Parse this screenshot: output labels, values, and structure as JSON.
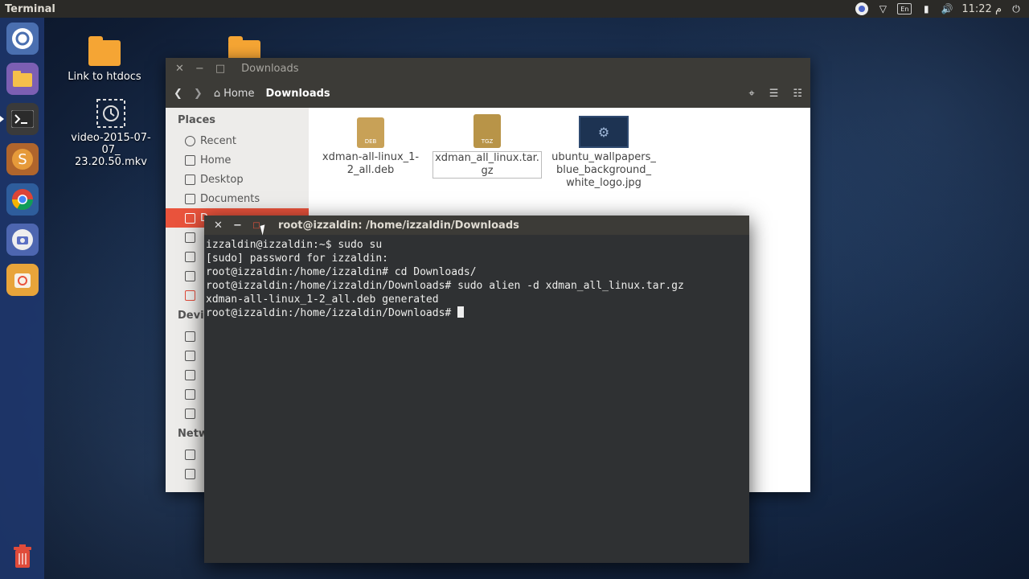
{
  "top_panel": {
    "app_title": "Terminal",
    "kbd": "En",
    "clock": "11:22 م"
  },
  "desktop": {
    "icons": [
      {
        "label": "Link to htdocs"
      },
      {
        "label": ""
      },
      {
        "label": "video-2015-07-07_\n23.20.50.mkv"
      }
    ]
  },
  "file_manager": {
    "title": "Downloads",
    "breadcrumb": {
      "home": "Home",
      "current": "Downloads"
    },
    "sidebar": {
      "places_header": "Places",
      "items": [
        "Recent",
        "Home",
        "Desktop",
        "Documents",
        "D"
      ],
      "devices_header": "Devi",
      "network_header": "Netw"
    },
    "files": [
      {
        "name": "xdman-all-linux_1-\n2_all.deb",
        "badge": "DEB"
      },
      {
        "name": "xdman_all_linux.tar.\ngz",
        "badge": "TGZ"
      },
      {
        "name": "ubuntu_wallpapers_\nblue_background_\nwhite_logo.jpg",
        "badge": ""
      }
    ]
  },
  "terminal": {
    "title": "root@izzaldin: /home/izzaldin/Downloads",
    "lines": [
      "izzaldin@izzaldin:~$ sudo su",
      "[sudo] password for izzaldin:",
      "root@izzaldin:/home/izzaldin# cd Downloads/",
      "root@izzaldin:/home/izzaldin/Downloads# sudo alien -d xdman_all_linux.tar.gz",
      "xdman-all-linux_1-2_all.deb generated",
      "root@izzaldin:/home/izzaldin/Downloads# "
    ]
  },
  "colors": {
    "accent": "#e9533c",
    "panel": "#2b2a27",
    "titlebar": "#3c3b37",
    "terminal_bg": "#2f3133",
    "folder": "#f5a534"
  }
}
